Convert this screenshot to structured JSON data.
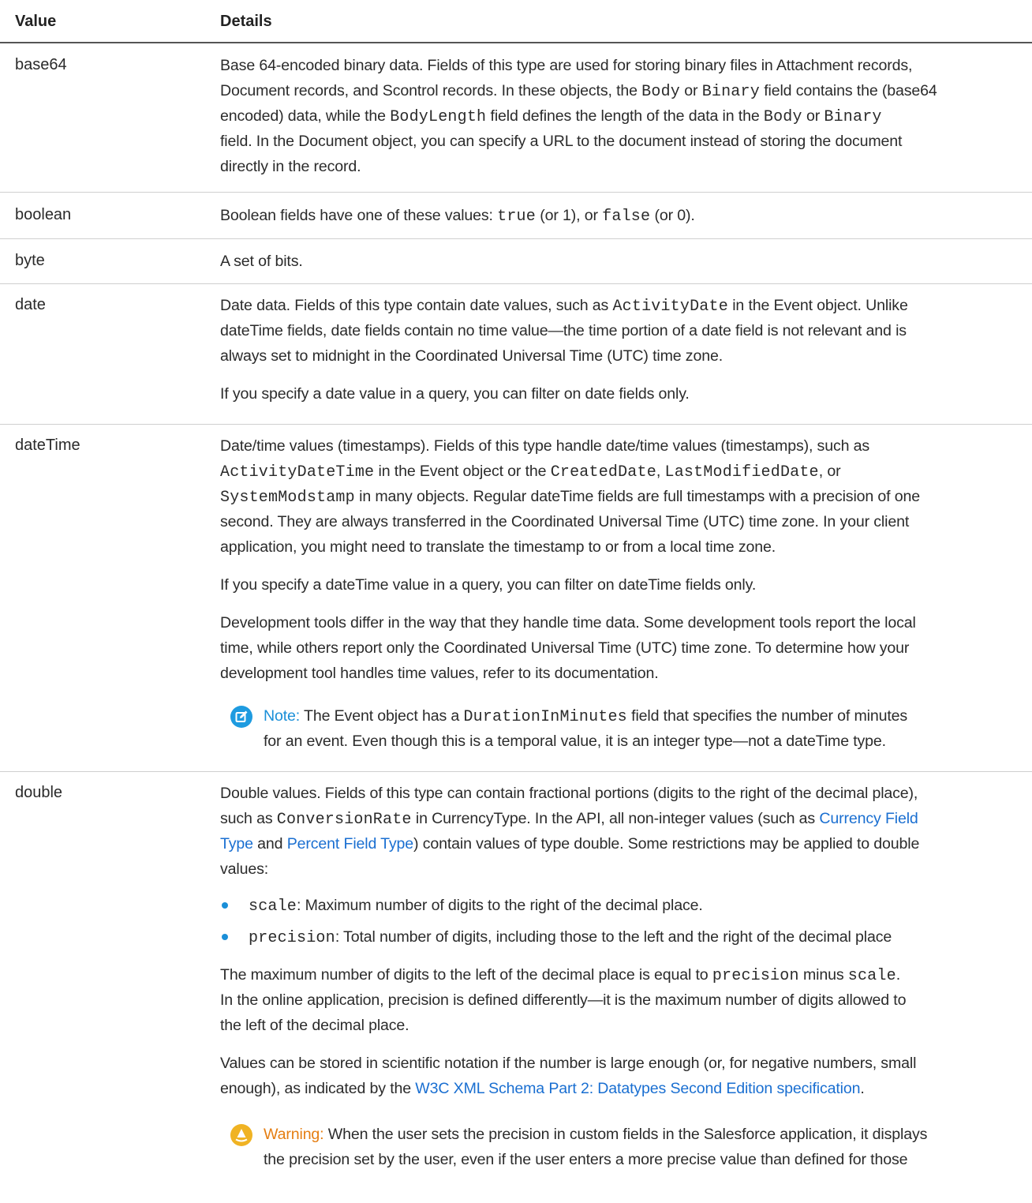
{
  "header": {
    "value": "Value",
    "details": "Details"
  },
  "rows": {
    "base64": {
      "value": "base64",
      "l1": "Base 64-encoded binary data. Fields of this type are used for storing binary files in Attachment records,",
      "l2a": "Document records, and Scontrol records. In these objects, the ",
      "l2b": "Body",
      "l2c": " or ",
      "l2d": "Binary",
      "l2e": " field contains the (base64",
      "l3a": "encoded) data, while the ",
      "l3b": "BodyLength",
      "l3c": " field defines the length of the data in the ",
      "l3d": "Body",
      "l3e": " or ",
      "l3f": "Binary",
      "l4": "field. In the Document object, you can specify a URL to the document instead of storing the document",
      "l5": "directly in the record."
    },
    "boolean": {
      "value": "boolean",
      "a": "Boolean fields have one of these values: ",
      "b": "true",
      "c": " (or 1), or ",
      "d": "false",
      "e": " (or 0)."
    },
    "byte": {
      "value": "byte",
      "text": "A set of bits."
    },
    "date": {
      "value": "date",
      "l1a": "Date data. Fields of this type contain date values, such as ",
      "l1b": "ActivityDate",
      "l1c": " in the Event object. Unlike",
      "l2": "dateTime fields, date fields contain no time value—the time portion of a date field is not relevant and is",
      "l3": "always set to midnight in the Coordinated Universal Time (UTC) time zone.",
      "p2": "If you specify a date value in a query, you can filter on date fields only."
    },
    "datetime": {
      "value": "dateTime",
      "l1": "Date/time values (timestamps). Fields of this type handle date/time values (timestamps), such as",
      "l2a": "ActivityDateTime",
      "l2b": " in the Event object or the ",
      "l2c": "CreatedDate",
      "l2d": ", ",
      "l2e": "LastModifiedDate",
      "l2f": ", or",
      "l3a": "SystemModstamp",
      "l3b": " in many objects. Regular dateTime fields are full timestamps with a precision of one",
      "l4": "second. They are always transferred in the Coordinated Universal Time (UTC) time zone. In your client",
      "l5": "application, you might need to translate the timestamp to or from a local time zone.",
      "p2": "If you specify a dateTime value in a query, you can filter on dateTime fields only.",
      "p3l1": "Development tools differ in the way that they handle time data. Some development tools report the local",
      "p3l2": "time, while others report only the Coordinated Universal Time (UTC) time zone. To determine how your",
      "p3l3": "development tool handles time values, refer to its documentation.",
      "note_label": "Note:",
      "note_l1a": " The Event object has a ",
      "note_l1b": "DurationInMinutes",
      "note_l1c": " field that specifies the number of minutes",
      "note_l2": "for an event. Even though this is a temporal value, it is an integer type—not a dateTime type."
    },
    "double": {
      "value": "double",
      "l1": "Double values. Fields of this type can contain fractional portions (digits to the right of the decimal place),",
      "l2a": "such as ",
      "l2b": "ConversionRate",
      "l2c": " in CurrencyType. In the API, all non-integer values (such as ",
      "l2d": "Currency Field",
      "l3a": "Type",
      "l3b": " and ",
      "l3c": "Percent Field Type",
      "l3d": ") contain values of type double. Some restrictions may be applied to double",
      "l4": "values:",
      "b1a": "scale",
      "b1b": ": Maximum number of digits to the right of the decimal place.",
      "b2a": "precision",
      "b2b": ": Total number of digits, including those to the left and the right of the decimal place",
      "p2l1a": "The maximum number of digits to the left of the decimal place is equal to ",
      "p2l1b": "precision",
      "p2l1c": " minus ",
      "p2l1d": "scale",
      "p2l1e": ".",
      "p2l2": "In the online application, precision is defined differently—it is the maximum number of digits allowed to",
      "p2l3": "the left of the decimal place.",
      "p3l1": "Values can be stored in scientific notation if the number is large enough (or, for negative numbers, small",
      "p3l2a": "enough), as indicated by the ",
      "p3l2b": "W3C XML Schema Part 2: Datatypes Second Edition specification",
      "p3l2c": ".",
      "warn_label": "Warning:",
      "warn_l1": "  When the user sets the precision in custom fields in the Salesforce application, it displays",
      "warn_l2": "the precision set by the user, even if the user enters a more precise value than defined for those"
    }
  },
  "colors": {
    "link": "#1a6fd1",
    "note": "#1e9be0",
    "warning": "#f0b323",
    "warning_text": "#e57e12",
    "bullet": "#1a8fd8"
  }
}
